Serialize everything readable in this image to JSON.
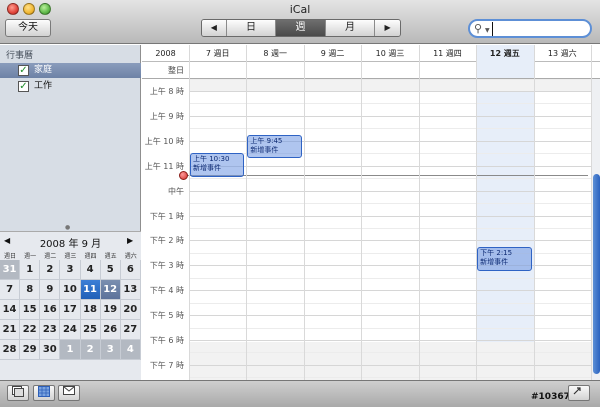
{
  "window": {
    "title": "iCal"
  },
  "toolbar": {
    "today_label": "今天",
    "prev_icon": "◀",
    "next_icon": "▶",
    "view_day": "日",
    "view_week": "週",
    "view_month": "月",
    "selected_view": "週"
  },
  "search": {
    "value": "",
    "placeholder": ""
  },
  "sidebar": {
    "header": "行事曆",
    "calendars": [
      {
        "label": "家庭",
        "checked": true,
        "selected": true
      },
      {
        "label": "工作",
        "checked": true,
        "selected": false
      }
    ]
  },
  "mini_calendar": {
    "title": "2008 年 9 月",
    "prev_icon": "◀",
    "next_icon": "▶",
    "weekdays": [
      "週日",
      "週一",
      "週二",
      "週三",
      "週四",
      "週五",
      "週六"
    ],
    "weeks": [
      [
        "31",
        "1",
        "2",
        "3",
        "4",
        "5",
        "6"
      ],
      [
        "7",
        "8",
        "9",
        "10",
        "11",
        "12",
        "13"
      ],
      [
        "14",
        "15",
        "16",
        "17",
        "18",
        "19",
        "20"
      ],
      [
        "21",
        "22",
        "23",
        "24",
        "25",
        "26",
        "27"
      ],
      [
        "28",
        "29",
        "30",
        "1",
        "2",
        "3",
        "4"
      ]
    ],
    "selected_day": "11",
    "today_day": "12"
  },
  "week_view": {
    "year": "2008",
    "allday_label": "整日",
    "days": [
      "7 週日",
      "8 週一",
      "9 週二",
      "10 週三",
      "11 週四",
      "12 週五",
      "13 週六"
    ],
    "today_index": 5,
    "time_labels": [
      "上午 8 時",
      "上午 9 時",
      "上午 10 時",
      "上午 11 時",
      "中午",
      "下午 1 時",
      "下午 2 時",
      "下午 3 時",
      "下午 4 時",
      "下午 5 時",
      "下午 6 時",
      "下午 7 時"
    ],
    "events": [
      {
        "time": "上午 9:45",
        "title": "新增事件",
        "day_index": 1
      },
      {
        "time": "上午 10:30",
        "title": "新增事件",
        "day_index": 0
      },
      {
        "time": "下午 2:15",
        "title": "新增事件",
        "day_index": 5
      }
    ]
  },
  "bottom_bar": {
    "watermark": "#1036746"
  },
  "colors": {
    "accent": "#2f63c4",
    "event_fill": "#8aa9e6",
    "today_column": "#e7eef9",
    "selection": "#1f5fb7"
  }
}
